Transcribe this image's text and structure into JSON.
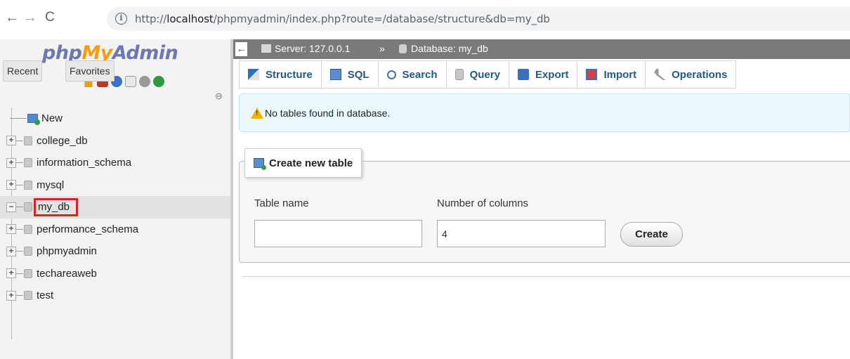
{
  "browser": {
    "back": "←",
    "forward": "→",
    "reload": "C",
    "info": "i",
    "url_prefix": "http://",
    "url_host": "localhost",
    "url_rest": "/phpmyadmin/index.php?route=/database/structure&db=my_db"
  },
  "sidebar": {
    "logo_php": "php",
    "logo_my": "My",
    "logo_admin": "Admin",
    "recent_label": "Recent",
    "favorites_label": "Favorites",
    "link_icon": "⊖",
    "tree": [
      {
        "label": "New",
        "kind": "new"
      },
      {
        "label": "college_db",
        "kind": "db"
      },
      {
        "label": "information_schema",
        "kind": "db"
      },
      {
        "label": "mysql",
        "kind": "db"
      },
      {
        "label": "my_db",
        "kind": "db",
        "selected": true
      },
      {
        "label": "performance_schema",
        "kind": "db"
      },
      {
        "label": "phpmyadmin",
        "kind": "db"
      },
      {
        "label": "techareaweb",
        "kind": "db"
      },
      {
        "label": "test",
        "kind": "db"
      }
    ],
    "expand_symbol": "+",
    "collapse_symbol": "−"
  },
  "topbar": {
    "collapse": "←",
    "server": "Server: 127.0.0.1",
    "sep": "»",
    "database": "Database: my_db"
  },
  "tabs": {
    "structure": "Structure",
    "sql": "SQL",
    "search": "Search",
    "query": "Query",
    "export": "Export",
    "import": "Import",
    "operations": "Operations"
  },
  "notice": {
    "text": "No tables found in database."
  },
  "create_table": {
    "legend": "Create new table",
    "table_name_label": "Table name",
    "table_name_value": "",
    "num_columns_label": "Number of columns",
    "num_columns_value": "4",
    "create_button": "Create"
  },
  "colors": {
    "logo_blue": "#6c78af",
    "logo_orange": "#f89c0e",
    "tab_text": "#235a81",
    "selected_outline": "#e02020"
  }
}
